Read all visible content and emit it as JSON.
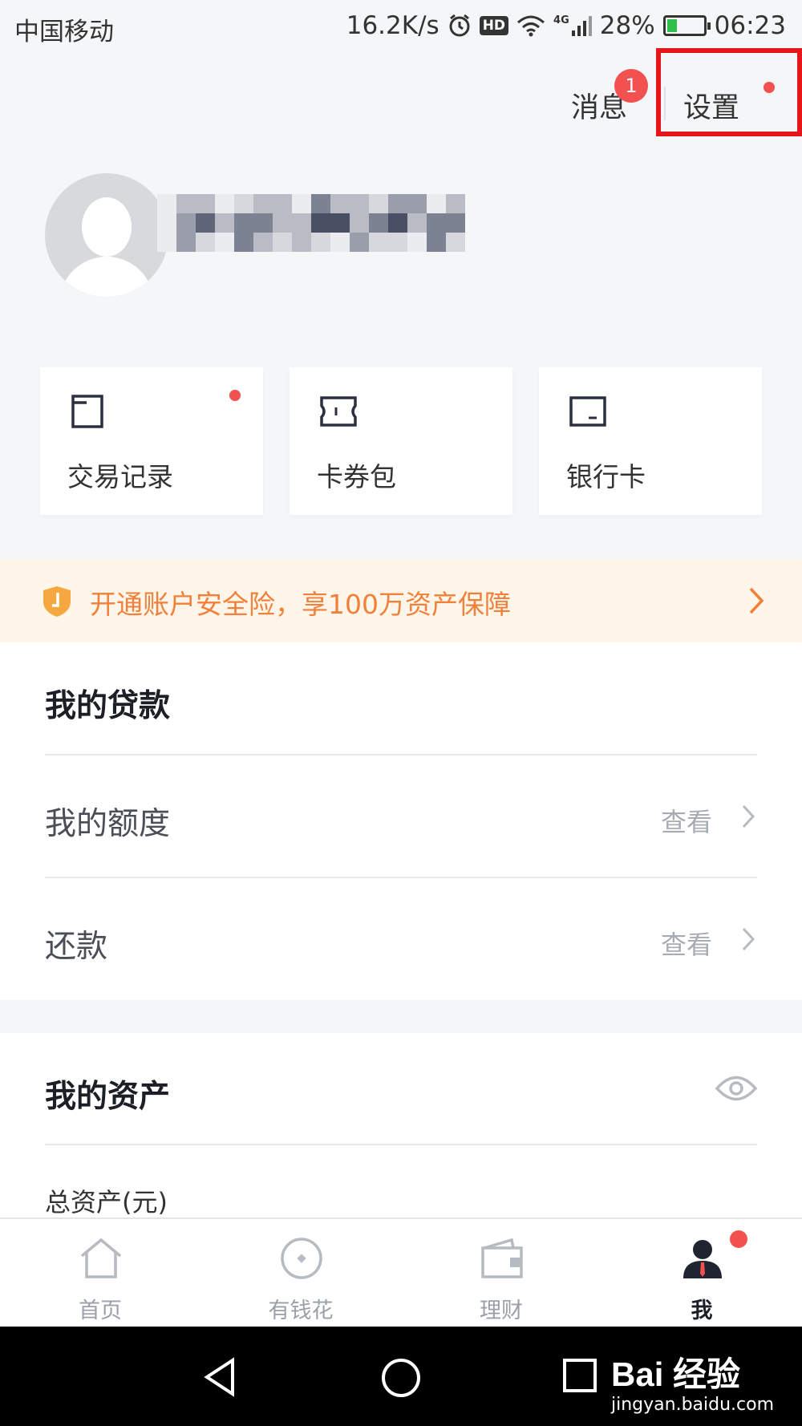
{
  "status_bar": {
    "carrier": "中国移动",
    "speed": "16.2K/s",
    "hd": "HD",
    "network": "4G",
    "battery": "28%",
    "battery_level": 0.28,
    "time": "06:23"
  },
  "header": {
    "messages_label": "消息",
    "messages_badge": "1",
    "settings_label": "设置"
  },
  "quick_actions": [
    {
      "label": "交易记录",
      "icon": "document-icon",
      "has_dot": true
    },
    {
      "label": "卡券包",
      "icon": "ticket-icon",
      "has_dot": false
    },
    {
      "label": "银行卡",
      "icon": "bank-card-icon",
      "has_dot": false
    }
  ],
  "banner": {
    "text": "开通账户安全险，享100万资产保障",
    "color": "#f0803a"
  },
  "loans": {
    "title": "我的贷款",
    "rows": [
      {
        "label": "我的额度",
        "action": "查看"
      },
      {
        "label": "还款",
        "action": "查看"
      }
    ]
  },
  "assets": {
    "title": "我的资产",
    "total_label": "总资产(元)"
  },
  "tab_bar": {
    "items": [
      {
        "label": "首页",
        "icon": "home-icon"
      },
      {
        "label": "有钱花",
        "icon": "coin-icon"
      },
      {
        "label": "理财",
        "icon": "wallet-icon"
      },
      {
        "label": "我",
        "icon": "profile-icon",
        "active": true
      }
    ]
  },
  "watermark": {
    "brand": "Bai 经验",
    "url": "jingyan.baidu.com"
  },
  "colors": {
    "accent_red": "#f35050",
    "highlight_red": "#e6161a",
    "banner_bg": "#fff5e8"
  }
}
